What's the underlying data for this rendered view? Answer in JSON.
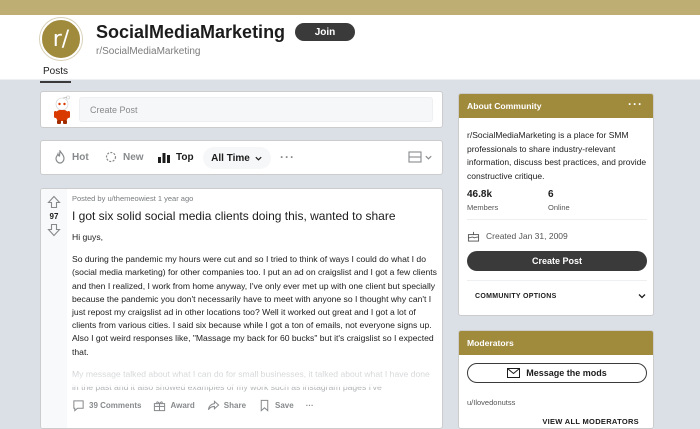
{
  "header": {
    "icon_text": "r/",
    "title": "SocialMediaMarketing",
    "name": "r/SocialMediaMarketing",
    "join_label": "Join",
    "tabs": [
      {
        "label": "Posts"
      }
    ]
  },
  "create_post": {
    "placeholder": "Create Post"
  },
  "sort_bar": {
    "hot": "Hot",
    "new": "New",
    "top": "Top",
    "time": "All Time",
    "more": "···"
  },
  "post": {
    "meta": "Posted by u/themeowiest 1 year ago",
    "votes": "97",
    "title": "I got six solid social media clients doing this, wanted to share",
    "paragraphs": [
      "Hi guys,",
      "So during the pandemic my hours were cut and so I tried to think of ways I could do what I do (social media marketing) for other companies too. I put an ad on craigslist and I got a few clients and then I realized, I work from home anyway, I've only ever met up with one client but specially because the pandemic you don't necessarily have to meet with anyone so I thought why can't I just repost my craigslist ad in other locations too? Well it worked out great and I got a lot of clients from various cities. I said six because while I got a ton of emails, not everyone signs up. Also I got weird responses like, \"Massage my back for 60 bucks\" but it's craigslist so I expected that.",
      "My message talked about what I can do for small businesses, it talked about what I have done in the past and it also showed examples of my work such as instagram pages I've"
    ],
    "actions": {
      "comments": "39 Comments",
      "award": "Award",
      "share": "Share",
      "save": "Save",
      "more": "···"
    }
  },
  "about": {
    "heading": "About Community",
    "description": "r/SocialMediaMarketing is a place for SMM professionals to share industry-relevant information, discuss best practices, and provide constructive critique.",
    "members_count": "46.8k",
    "members_label": "Members",
    "online_count": "6",
    "online_label": "Online",
    "created": "Created Jan 31, 2009",
    "create_post_label": "Create Post",
    "community_options": "COMMUNITY OPTIONS"
  },
  "moderators": {
    "heading": "Moderators",
    "message_label": "Message the mods",
    "user": "u/Ilovedonutss",
    "view_all": "VIEW ALL MODERATORS"
  },
  "colors": {
    "accent": "#a08a3c",
    "banner": "#bfae74",
    "button_dark": "#3a3a3a",
    "page_bg": "#dae0e6"
  }
}
